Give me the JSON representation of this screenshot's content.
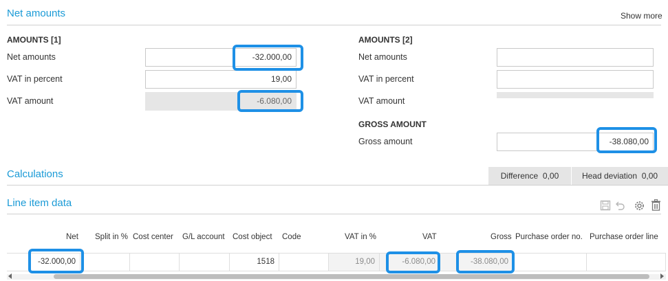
{
  "net_amounts": {
    "title": "Net amounts",
    "show_more": "Show more",
    "group1": {
      "heading": "AMOUNTS [1]",
      "net_label": "Net amounts",
      "net_value": "-32.000,00",
      "vat_pct_label": "VAT in percent",
      "vat_pct_value": "19,00",
      "vat_amount_label": "VAT amount",
      "vat_amount_value": "-6.080,00"
    },
    "group2": {
      "heading": "AMOUNTS [2]",
      "net_label": "Net amounts",
      "net_value": "",
      "vat_pct_label": "VAT in percent",
      "vat_pct_value": "",
      "vat_amount_label": "VAT amount",
      "vat_amount_value": ""
    },
    "gross": {
      "heading": "GROSS AMOUNT",
      "label": "Gross amount",
      "value": "-38.080,00"
    }
  },
  "calculations": {
    "title": "Calculations",
    "difference_label": "Difference",
    "difference_value": "0,00",
    "head_deviation_label": "Head deviation",
    "head_deviation_value": "0,00"
  },
  "line_items": {
    "title": "Line item data",
    "columns": [
      "Net",
      "Split in %",
      "Cost center",
      "G/L account",
      "Cost object",
      "Code",
      "VAT in %",
      "VAT",
      "Gross",
      "Purchase order no.",
      "Purchase order line"
    ],
    "row": {
      "net": "-32.000,00",
      "split": "",
      "cost_center": "",
      "gl_account": "",
      "cost_object": "1518",
      "code": "",
      "vat_pct": "19,00",
      "vat": "-6.080,00",
      "gross": "-38.080,00",
      "po_no": "",
      "po_line": ""
    }
  },
  "colors": {
    "accent": "#1a9ad6",
    "highlight": "#1e90e6"
  },
  "icons": [
    "save-icon",
    "undo-icon",
    "settings-gear-icon",
    "trash-icon",
    "scroll-left-arrow-icon",
    "scroll-right-arrow-icon"
  ]
}
